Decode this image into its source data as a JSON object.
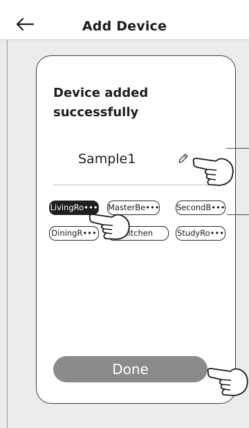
{
  "header": {
    "title": "Add Device",
    "back_icon": "arrow-left-icon"
  },
  "card": {
    "success_message": "Device added successfully",
    "device_name": "Sample1",
    "edit_icon": "pencil-icon",
    "rooms": [
      {
        "label": "LivingRo•••",
        "selected": true
      },
      {
        "label": "MasterBe•••",
        "selected": false
      },
      {
        "label": "SecondB•••",
        "selected": false
      },
      {
        "label": "DiningR•••",
        "selected": false
      },
      {
        "label": "Kitchen",
        "selected": false
      },
      {
        "label": "StudyRo•••",
        "selected": false
      }
    ],
    "done_label": "Done"
  },
  "colors": {
    "selected_chip": "#1e1e1e",
    "done_button": "#8b8b8b",
    "background": "#ececec"
  }
}
